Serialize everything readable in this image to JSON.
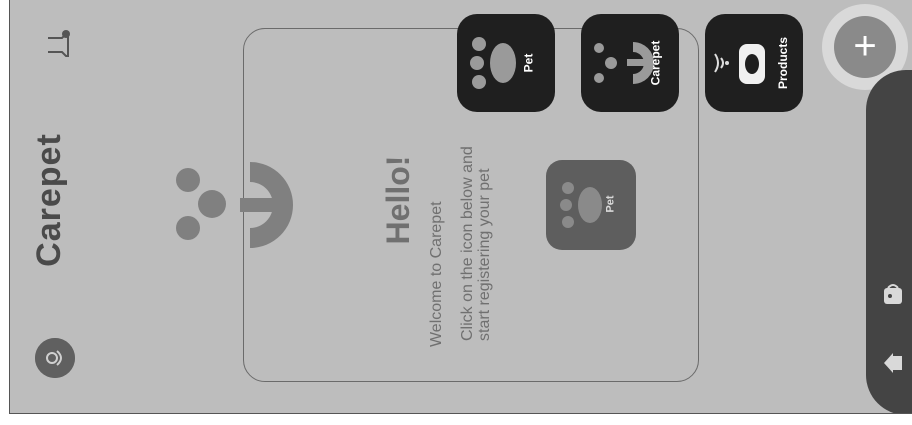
{
  "app": {
    "brand": "Carepet"
  },
  "welcome_card": {
    "greeting": "Hello!",
    "line1": "Welcome to Carepet",
    "line2": "Click on the icon below and",
    "line3": "start registering your pet"
  },
  "middle_tile": {
    "label": "Pet"
  },
  "quick_actions": [
    {
      "label": "Pet",
      "icon": "paw-icon"
    },
    {
      "label": "Carepet",
      "icon": "carepet-logo-icon"
    },
    {
      "label": "Products",
      "icon": "smart-feeder-icon"
    }
  ],
  "fab": {
    "symbol": "+"
  },
  "colors": {
    "screen_bg": "#bdbdbd",
    "tile_bg": "#1f1f1f",
    "nav_bar": "#444444",
    "fab": "#8a8a8a"
  }
}
